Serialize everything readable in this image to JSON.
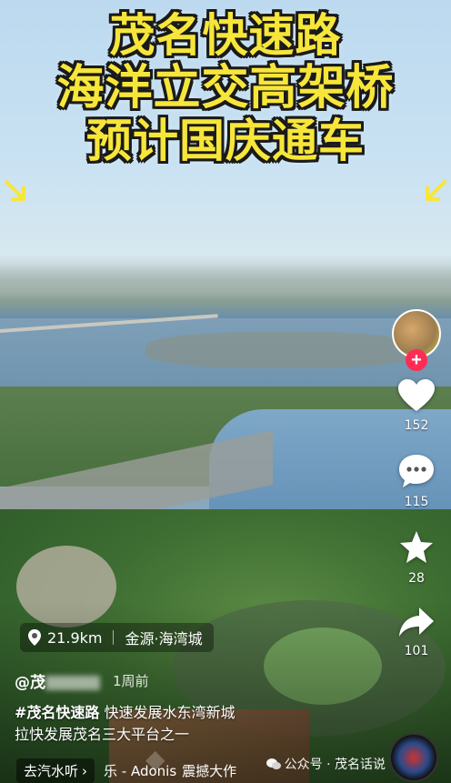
{
  "video": {
    "title_lines": [
      "茂名快速路",
      "海洋立交高架桥",
      "预计国庆通车"
    ]
  },
  "rail": {
    "follow_label": "+",
    "like_count": "152",
    "comment_count": "115",
    "favorite_count": "28",
    "share_count": "101"
  },
  "location": {
    "distance": "21.9km",
    "place": "金源·海湾城"
  },
  "author": {
    "prefix": "@茂",
    "time": "1周前"
  },
  "caption": {
    "hashtag": "#茂名快速路",
    "line1_rest": " 快速发展水东湾新城",
    "line2": "拉快发展茂名三大平台之一"
  },
  "music": {
    "chip_label": "去汽水听",
    "chip_arrow": "›",
    "note": "乐 - Adonis",
    "title": "震撼大作"
  },
  "watermark": {
    "text": "公众号 · 茂名话说"
  },
  "icons": {
    "location": "location-pin-icon",
    "like": "heart-icon",
    "comment": "comment-bubble-icon",
    "favorite": "star-icon",
    "share": "share-arrow-icon",
    "music": "music-disc-icon"
  },
  "colors": {
    "title_yellow": "#f7e63a",
    "follow_red": "#fe2c55"
  }
}
